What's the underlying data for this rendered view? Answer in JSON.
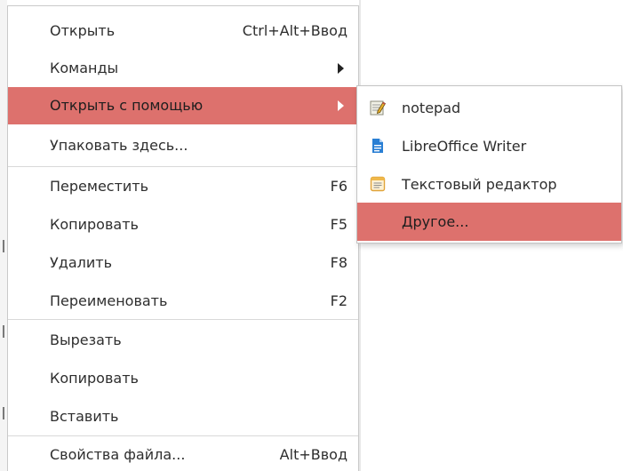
{
  "context_menu": {
    "items": [
      {
        "label": "Открыть",
        "shortcut": "Ctrl+Alt+Ввод"
      },
      {
        "label": "Команды"
      },
      {
        "label": "Открыть с помощью"
      },
      {
        "label": "Упаковать здесь..."
      },
      {
        "label": "Переместить",
        "shortcut": "F6"
      },
      {
        "label": "Копировать",
        "shortcut": "F5"
      },
      {
        "label": "Удалить",
        "shortcut": "F8"
      },
      {
        "label": "Переименовать",
        "shortcut": "F2"
      },
      {
        "label": "Вырезать"
      },
      {
        "label": "Копировать"
      },
      {
        "label": "Вставить"
      },
      {
        "label": "Свойства файла...",
        "shortcut": "Alt+Ввод"
      }
    ],
    "active_index": 2,
    "highlight_color": "#dd716d"
  },
  "submenu": {
    "items": [
      {
        "label": "notepad",
        "icon": "notepad-icon"
      },
      {
        "label": "LibreOffice Writer",
        "icon": "libreoffice-writer-icon"
      },
      {
        "label": "Текстовый редактор",
        "icon": "text-editor-icon"
      },
      {
        "label": "Другое..."
      }
    ],
    "active_index": 3
  }
}
